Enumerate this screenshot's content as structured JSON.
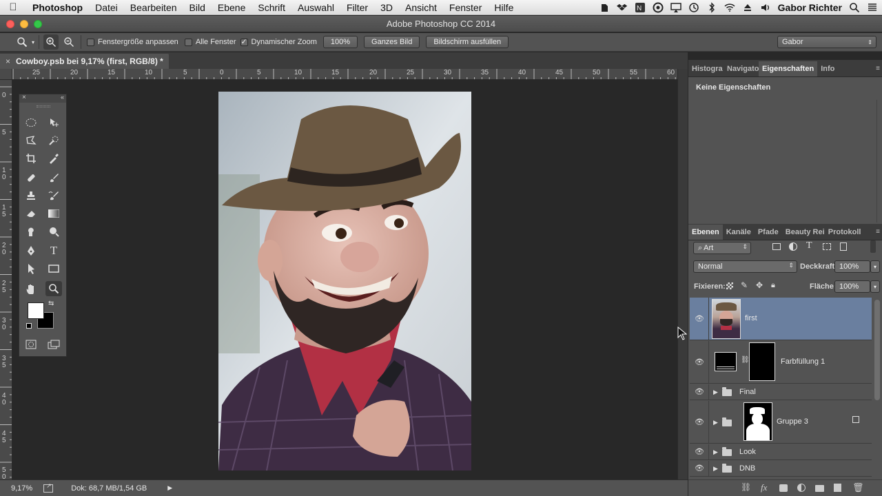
{
  "menubar": {
    "app": "Photoshop",
    "items": [
      "Datei",
      "Bearbeiten",
      "Bild",
      "Ebene",
      "Schrift",
      "Auswahl",
      "Filter",
      "3D",
      "Ansicht",
      "Fenster",
      "Hilfe"
    ],
    "user": "Gabor Richter"
  },
  "window": {
    "title": "Adobe Photoshop CC 2014"
  },
  "options": {
    "fit_window": "Fenstergröße anpassen",
    "all_windows": "Alle Fenster",
    "scrubby_zoom": "Dynamischer Zoom",
    "zoom_100": "100%",
    "fit_screen": "Ganzes Bild",
    "fill_screen": "Bildschirm ausfüllen",
    "workspace": "Gabor"
  },
  "document": {
    "tab_title": "Cowboy.psb bei 9,17% (first, RGB/8) *"
  },
  "ruler": {
    "top": [
      "25",
      "20",
      "15",
      "10",
      "5",
      "0",
      "5",
      "10",
      "15",
      "20",
      "25",
      "30",
      "35",
      "40",
      "45",
      "50",
      "55",
      "60"
    ],
    "left": [
      "0",
      "5",
      "1\n0",
      "1\n5",
      "2\n0",
      "2\n5",
      "3\n0",
      "3\n5",
      "4\n0",
      "4\n5",
      "5\n0"
    ]
  },
  "status": {
    "zoom": "9,17%",
    "doc": "Dok: 68,7 MB/1,54 GB"
  },
  "top_panel": {
    "tabs": [
      "Histogra",
      "Navigato",
      "Eigenschaften",
      "Info"
    ],
    "active": "Eigenschaften",
    "content": "Keine Eigenschaften"
  },
  "layers_panel": {
    "tabs": [
      "Ebenen",
      "Kanäle",
      "Pfade",
      "Beauty Rei",
      "Protokoll"
    ],
    "active": "Ebenen",
    "filter": "Art",
    "blend_mode": "Normal",
    "opacity_label": "Deckkraft:",
    "opacity": "100%",
    "lock_label": "Fixieren:",
    "fill_label": "Fläche:",
    "fill": "100%",
    "layers": [
      {
        "name": "first",
        "type": "image",
        "selected": true
      },
      {
        "name": "Farbfüllung 1",
        "type": "fill",
        "selected": false
      },
      {
        "name": "Final",
        "type": "group",
        "selected": false
      },
      {
        "name": "Gruppe 3",
        "type": "group-mask",
        "selected": false
      },
      {
        "name": "Look",
        "type": "group",
        "selected": false
      },
      {
        "name": "DNB",
        "type": "group",
        "selected": false
      }
    ]
  },
  "colors": {
    "selected_layer": "#6a7f9f",
    "panel_bg": "#535353",
    "canvas_bg": "#282828"
  }
}
